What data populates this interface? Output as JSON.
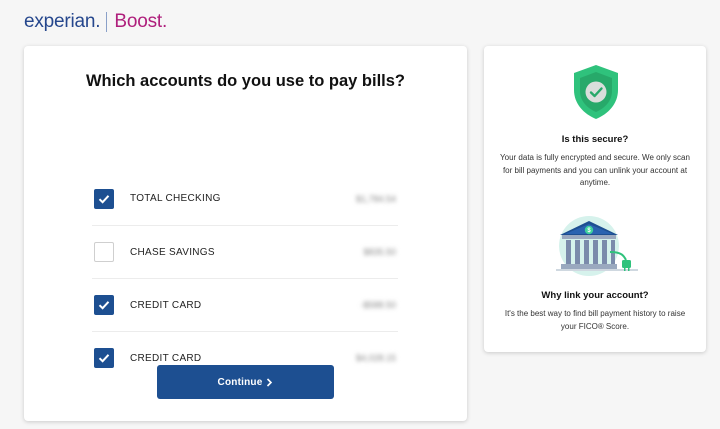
{
  "brand": {
    "name": "experian.",
    "product": "Boost."
  },
  "main": {
    "question": "Which accounts do you use to pay bills?",
    "accounts": [
      {
        "name": "TOTAL CHECKING",
        "checked": true,
        "amount": "$1,784.54"
      },
      {
        "name": "CHASE SAVINGS",
        "checked": false,
        "amount": "$835.50"
      },
      {
        "name": "CREDIT CARD",
        "checked": true,
        "amount": "-$588.50"
      },
      {
        "name": "CREDIT CARD",
        "checked": true,
        "amount": "$4,028.15"
      }
    ],
    "continue_label": "Continue"
  },
  "side": {
    "secure_heading": "Is this secure?",
    "secure_text": "Your data is fully encrypted and secure. We only scan for bill payments and you can unlink your account at anytime.",
    "why_heading": "Why link your account?",
    "why_text": "It's the best way to find bill payment history to raise your FICO® Score."
  },
  "colors": {
    "brand_blue": "#26478d",
    "brand_magenta": "#af1f7c",
    "primary_button": "#1d4f91",
    "shield_green": "#2fc27c"
  },
  "icons": [
    "checkmark-icon",
    "chevron-right-icon",
    "shield-check-icon",
    "bank-icon",
    "plug-icon"
  ]
}
